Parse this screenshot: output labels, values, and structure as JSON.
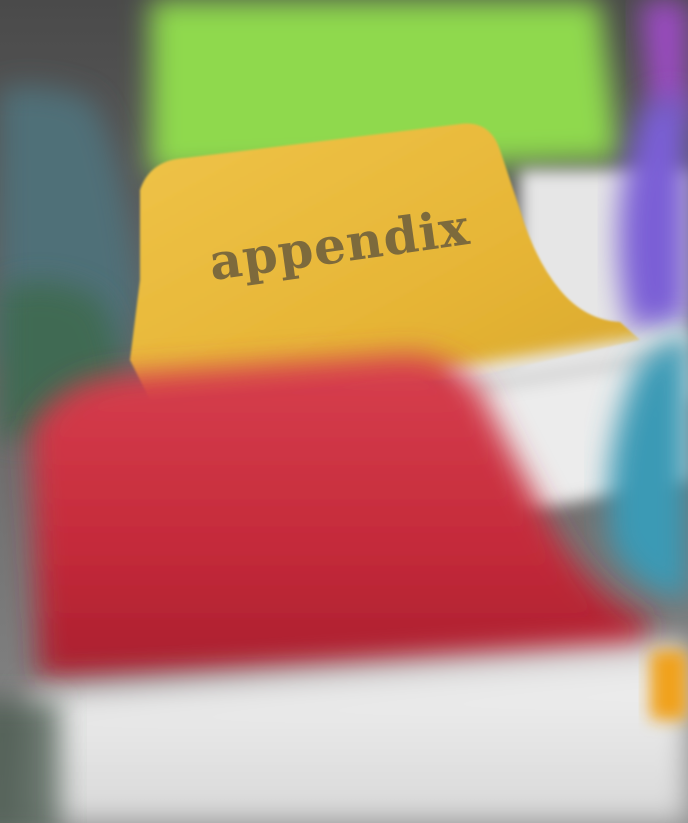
{
  "photo": {
    "subject": "index-divider-tabs",
    "focused_tab": {
      "label": "appendix",
      "color": "#e8b93a",
      "label_color": "#7d6a3c"
    },
    "tab_colors": {
      "green": "#8fd94e",
      "red": "#c62b3b",
      "teal_left": "#4f6f78",
      "dark_green_left": "#3f6a52",
      "purple_right": "#7a5fd6",
      "magenta_right": "#9b4cc2",
      "cyan_right": "#3a9ab5",
      "orange_corner": "#f0a21a"
    },
    "background_color": "#5a5a5a",
    "paper_color": "#ececec"
  }
}
